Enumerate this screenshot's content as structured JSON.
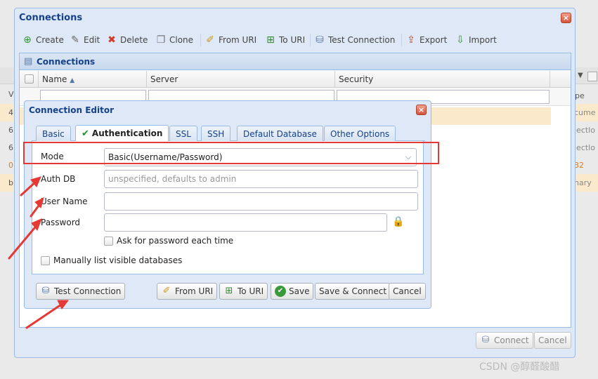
{
  "background": {
    "left_cells": [
      {
        "text": "4 {",
        "highlight": true,
        "orange": false
      },
      {
        "text": "6",
        "highlight": false,
        "orange": false
      },
      {
        "text": "6",
        "highlight": false,
        "orange": false
      },
      {
        "text": "0",
        "highlight": false,
        "orange": true
      },
      {
        "text": "b",
        "highlight": true,
        "orange": false
      }
    ],
    "left_header": "V",
    "right_header": "pe",
    "right_cells": [
      {
        "text": "cume",
        "highlight": true,
        "orange": false
      },
      {
        "text": "jectlo",
        "highlight": false,
        "orange": false
      },
      {
        "text": "jectlo",
        "highlight": false,
        "orange": false
      },
      {
        "text": "32",
        "highlight": false,
        "orange": true
      },
      {
        "text": "nary",
        "highlight": true,
        "orange": false
      }
    ]
  },
  "connections": {
    "title": "Connections",
    "toolbar": {
      "create": "Create",
      "edit": "Edit",
      "delete": "Delete",
      "clone": "Clone",
      "from_uri": "From URI",
      "to_uri": "To URI",
      "test_connection": "Test Connection",
      "export": "Export",
      "import": "Import"
    },
    "panel_title": "Connections",
    "grid_columns": [
      "Name",
      "Server",
      "Security"
    ],
    "footer": {
      "connect": "Connect",
      "cancel": "Cancel"
    }
  },
  "editor": {
    "title": "Connection Editor",
    "tabs": [
      "Basic",
      "Authentication",
      "SSL",
      "SSH",
      "Default Database",
      "Other Options"
    ],
    "active_tab": "Authentication",
    "form": {
      "mode_label": "Mode",
      "mode_value": "Basic(Username/Password)",
      "auth_db_label": "Auth DB",
      "auth_db_placeholder": "unspecified, defaults to admin",
      "user_name_label": "User Name",
      "user_name_value": "",
      "password_label": "Password",
      "password_value": "",
      "ask_password": "Ask for password each time",
      "manual_dbs": "Manually list visible databases"
    },
    "footer": {
      "test_connection": "Test Connection",
      "from_uri": "From URI",
      "to_uri": "To URI",
      "save": "Save",
      "save_connect": "Save & Connect",
      "cancel": "Cancel"
    }
  },
  "annotation_color": "#e53935",
  "accent_color": "#15428b",
  "watermark": "CSDN @醇醛酸醋"
}
